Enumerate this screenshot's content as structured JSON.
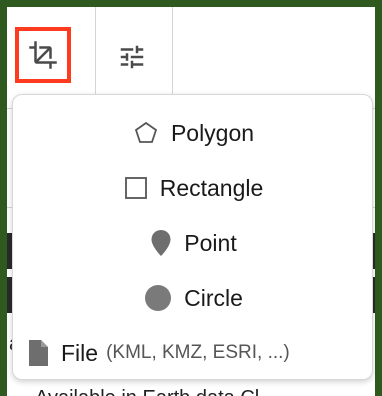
{
  "menu": {
    "items": [
      {
        "label": "Polygon",
        "icon": "polygon-icon"
      },
      {
        "label": "Rectangle",
        "icon": "rectangle-icon"
      },
      {
        "label": "Point",
        "icon": "map-pin-icon"
      },
      {
        "label": "Circle",
        "icon": "circle-icon"
      },
      {
        "label": "File",
        "sublabel": "(KML, KMZ, ESRI, ...)",
        "icon": "file-icon"
      }
    ]
  },
  "toolbar": {
    "crop_icon": "crop-icon",
    "tune_icon": "tune-icon"
  },
  "background": {
    "text_fragment_1": "a",
    "text_fragment_2": "Available in Earth data Cl"
  },
  "colors": {
    "frame": "#2f5a1f",
    "highlight": "#ff3b1f",
    "icon": "#4a4a4a"
  }
}
